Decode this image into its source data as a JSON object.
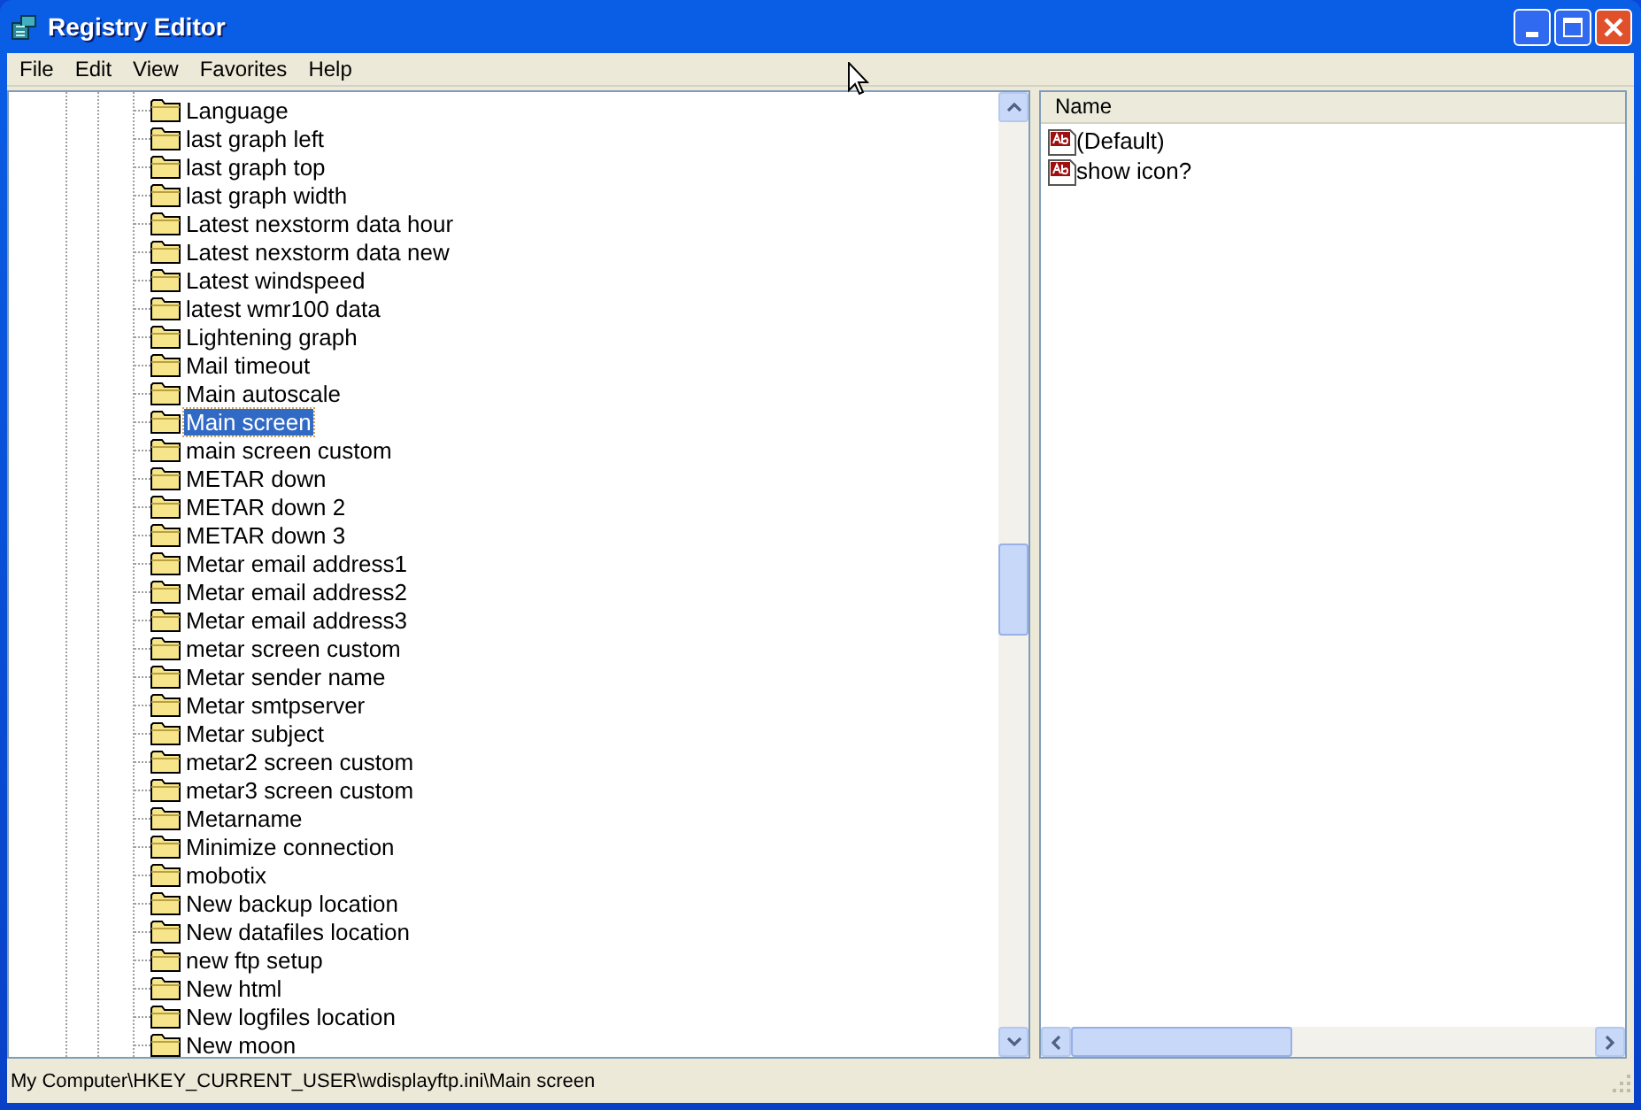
{
  "window": {
    "title": "Registry Editor"
  },
  "menu": [
    "File",
    "Edit",
    "View",
    "Favorites",
    "Help"
  ],
  "tree": {
    "items": [
      {
        "label": "Language",
        "selected": false
      },
      {
        "label": "last graph left",
        "selected": false
      },
      {
        "label": "last graph top",
        "selected": false
      },
      {
        "label": "last graph width",
        "selected": false
      },
      {
        "label": "Latest nexstorm data hour",
        "selected": false
      },
      {
        "label": "Latest nexstorm data new",
        "selected": false
      },
      {
        "label": "Latest windspeed",
        "selected": false
      },
      {
        "label": "latest wmr100 data",
        "selected": false
      },
      {
        "label": "Lightening graph",
        "selected": false
      },
      {
        "label": "Mail timeout",
        "selected": false
      },
      {
        "label": "Main autoscale",
        "selected": false
      },
      {
        "label": "Main screen",
        "selected": true
      },
      {
        "label": "main screen custom",
        "selected": false
      },
      {
        "label": "METAR down",
        "selected": false
      },
      {
        "label": "METAR down 2",
        "selected": false
      },
      {
        "label": "METAR down 3",
        "selected": false
      },
      {
        "label": "Metar email address1",
        "selected": false
      },
      {
        "label": "Metar email address2",
        "selected": false
      },
      {
        "label": "Metar email address3",
        "selected": false
      },
      {
        "label": "metar screen custom",
        "selected": false
      },
      {
        "label": "Metar sender name",
        "selected": false
      },
      {
        "label": "Metar smtpserver",
        "selected": false
      },
      {
        "label": "Metar subject",
        "selected": false
      },
      {
        "label": "metar2 screen custom",
        "selected": false
      },
      {
        "label": "metar3 screen custom",
        "selected": false
      },
      {
        "label": "Metarname",
        "selected": false
      },
      {
        "label": "Minimize connection",
        "selected": false
      },
      {
        "label": "mobotix",
        "selected": false
      },
      {
        "label": "New backup location",
        "selected": false
      },
      {
        "label": "New datafiles location",
        "selected": false
      },
      {
        "label": "new ftp setup",
        "selected": false
      },
      {
        "label": "New html",
        "selected": false
      },
      {
        "label": "New logfiles location",
        "selected": false
      },
      {
        "label": "New moon",
        "selected": false
      }
    ]
  },
  "values": {
    "columns": [
      "Name"
    ],
    "rows": [
      {
        "name": "(Default)"
      },
      {
        "name": "show icon?"
      }
    ]
  },
  "status_bar": "My Computer\\HKEY_CURRENT_USER\\wdisplayftp.ini\\Main screen"
}
